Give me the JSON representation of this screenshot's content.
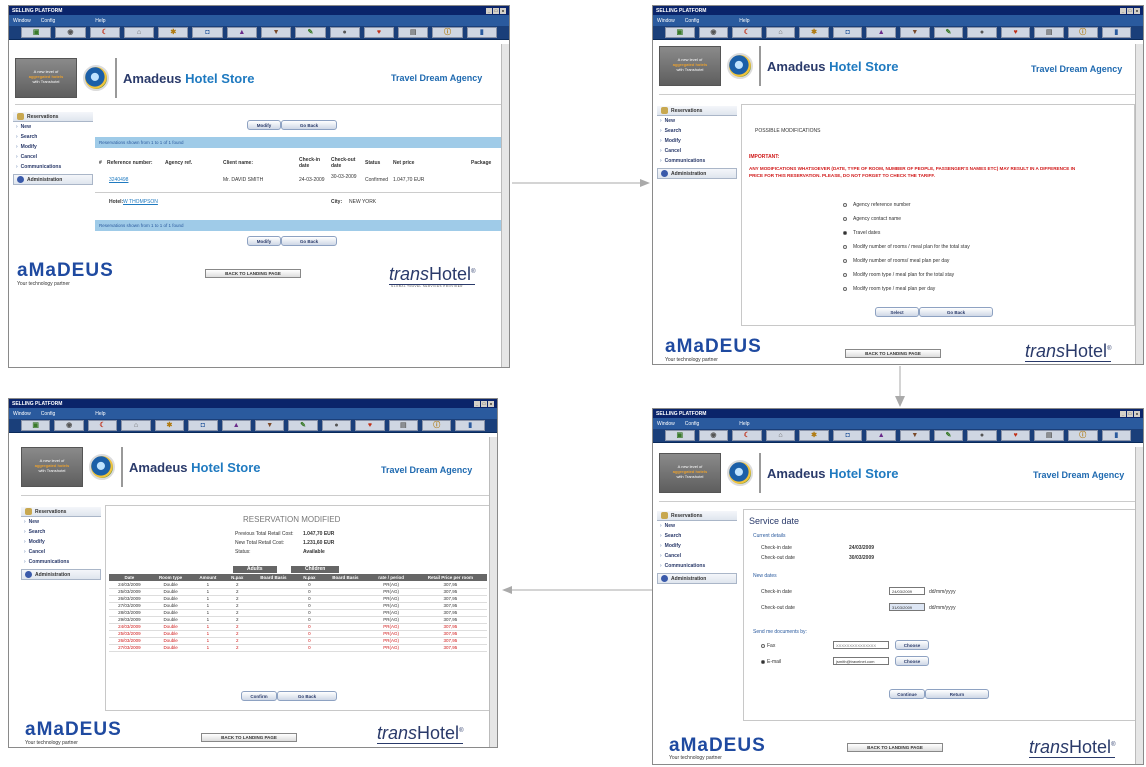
{
  "window": {
    "title": "SELLING PLATFORM",
    "menu": [
      "Window",
      "Config",
      "Help"
    ]
  },
  "toolbar_icons": [
    "window-icon",
    "earth-icon",
    "weather-icon",
    "hotel-icon",
    "tools-icon",
    "car-icon",
    "flag-icon",
    "train-icon",
    "pen-icon",
    "globe-icon",
    "heart-icon",
    "document-icon",
    "info-icon",
    "chart-icon"
  ],
  "header": {
    "promo_line1": "A new level of",
    "promo_line2": "aggregated hotels",
    "promo_line3": "with Transhotel",
    "brand_part1": "Amadeus",
    "brand_part2": "Hotel Store",
    "agency": "Travel Dream Agency"
  },
  "sidebar": {
    "reservations": "Reservations",
    "items": [
      "New",
      "Search",
      "Modify",
      "Cancel",
      "Communications"
    ],
    "administration": "Administration"
  },
  "footer": {
    "amadeus": "aMaDEUS",
    "tagline": "Your technology partner",
    "back": "BACK TO LANDING PAGE",
    "transhotel_a": "trans",
    "transhotel_b": "Hotel",
    "transhotel_sub": "GLOBAL TRAVEL SERVICES PROVIDER",
    "reg": "®"
  },
  "screen1": {
    "modify": "Modify",
    "goback": "Go Back",
    "shown": "Reservations shown from 1 to 1 of 1 found",
    "headers": {
      "ref": "Reference number:",
      "agency": "Agency ref.",
      "client": "Client name:",
      "checkin_a": "Check-in",
      "checkin_b": "date",
      "checkout_a": "Check-out",
      "checkout_b": "date",
      "status": "Status",
      "price": "Net price",
      "package": "Package"
    },
    "sort": "#",
    "row": {
      "ref": "3240498",
      "client": "Mr. DAVID SMITH",
      "checkin": "24-03-2009",
      "checkout": "30-03-2009",
      "status": "Confirmed",
      "price": "1.047,70 EUR"
    },
    "hotel_label": "Hotel:",
    "hotel": "W THOMPSON",
    "city_label": "City:",
    "city": "NEW YORK"
  },
  "screen2": {
    "title": "POSSIBLE MODIFICATIONS",
    "important": "IMPORTANT:",
    "warning1": "ANY MODIFICATIONS WHATSOEVER (DATE, TYPE OF ROOM, NUMBER OF PEOPLE, PASSENGER'S NAMES ETC) MAY RESULT IN A DIFFERENCE IN",
    "warning2": "PRICE FOR THIS RESERVATION. PLEASE, DO NOT FORGET TO CHECK THE TARIFF.",
    "options": [
      "Agency reference number",
      "Agency contact name",
      "Travel dates",
      "Modify number of rooms / meal plan for the total stay",
      "Modify number of rooms/ meal plan per day",
      "Modify room type / meal plan for the total stay",
      "Modify room type / meal plan per day"
    ],
    "selected_index": 2,
    "select": "Select",
    "goback": "Go Back"
  },
  "screen3": {
    "title": "Service date",
    "current": "Current details",
    "checkin_label": "Check-in date",
    "checkin": "24/03/2009",
    "checkout_label": "Check-out date",
    "checkout": "30/03/2009",
    "new": "New dates",
    "new_checkin": "24/03/2009",
    "new_checkout": "31/03/2009",
    "fmt": "dd/mm/yyyy",
    "send": "Send me documents by:",
    "fax": "Fax",
    "fax_value": "XXXXXXXXXXXXXXX",
    "email": "E-mail",
    "email_value": "jsmith@travelnet.com",
    "choose": "Choose",
    "confirm": "Continue",
    "return": "Return"
  },
  "screen4": {
    "title": "RESERVATION MODIFIED",
    "prev_label": "Previous Total Retail Cost:",
    "prev": "1.047,70 EUR",
    "new_label": "New Total Retail Cost:",
    "new": "1.231,60 EUR",
    "status_label": "Status:",
    "status": "Available",
    "group_adults": "Adults",
    "group_children": "Children",
    "cols": [
      "Date",
      "Room type",
      "Amount",
      "N.pax",
      "Board Basis",
      "N.pax",
      "Board Basis",
      "rate / period",
      "Retail Price per room"
    ],
    "rows": [
      [
        "24/03/2009",
        "Double",
        "1",
        "2",
        "",
        "0",
        "",
        "PR(AG)",
        "307,95"
      ],
      [
        "25/03/2009",
        "Double",
        "1",
        "2",
        "",
        "0",
        "",
        "PR(AG)",
        "307,95"
      ],
      [
        "26/03/2009",
        "Double",
        "1",
        "2",
        "",
        "0",
        "",
        "PR(AG)",
        "307,95"
      ],
      [
        "27/03/2009",
        "Double",
        "1",
        "2",
        "",
        "0",
        "",
        "PR(AG)",
        "307,95"
      ],
      [
        "28/03/2009",
        "Double",
        "1",
        "2",
        "",
        "0",
        "",
        "PR(AG)",
        "307,95"
      ],
      [
        "29/03/2009",
        "Double",
        "1",
        "2",
        "",
        "0",
        "",
        "PR(AG)",
        "307,95"
      ],
      [
        "24/03/2009",
        "Double",
        "1",
        "2",
        "",
        "0",
        "",
        "PR(AG)",
        "307,95"
      ],
      [
        "25/03/2009",
        "Double",
        "1",
        "2",
        "",
        "0",
        "",
        "PR(AG)",
        "307,95"
      ],
      [
        "26/03/2009",
        "Double",
        "1",
        "2",
        "",
        "0",
        "",
        "PR(AG)",
        "307,95"
      ],
      [
        "27/03/2009",
        "Double",
        "1",
        "2",
        "",
        "0",
        "",
        "PR(AG)",
        "307,95"
      ]
    ],
    "red_from": 6,
    "confirm": "Confirm",
    "goback": "Go Back"
  }
}
